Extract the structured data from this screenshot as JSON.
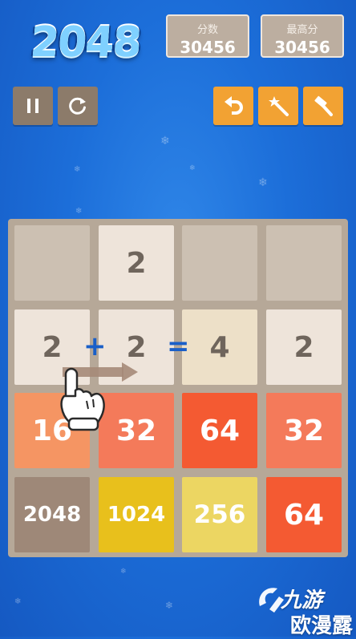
{
  "header": {
    "logo_text": "2048",
    "score": {
      "label": "分数",
      "value": "30456"
    },
    "best": {
      "label": "最高分",
      "value": "30456"
    }
  },
  "controls": {
    "pause_icon": "pause-icon",
    "restart_icon": "restart-icon",
    "undo_icon": "undo-icon",
    "magic_icon": "magic-wand-icon",
    "hammer_icon": "hammer-icon",
    "gray_color": "#8c7b6a",
    "orange_color": "#f2a233"
  },
  "board": {
    "rows": [
      [
        "",
        "2",
        "",
        ""
      ],
      [
        "2",
        "2",
        "4",
        "2"
      ],
      [
        "16",
        "32",
        "64",
        "32"
      ],
      [
        "2048",
        "1024",
        "256",
        "64"
      ]
    ]
  },
  "tutorial": {
    "plus": "+",
    "equals": "="
  },
  "watermark": {
    "line1": "九游",
    "line2": "欧漫露"
  }
}
